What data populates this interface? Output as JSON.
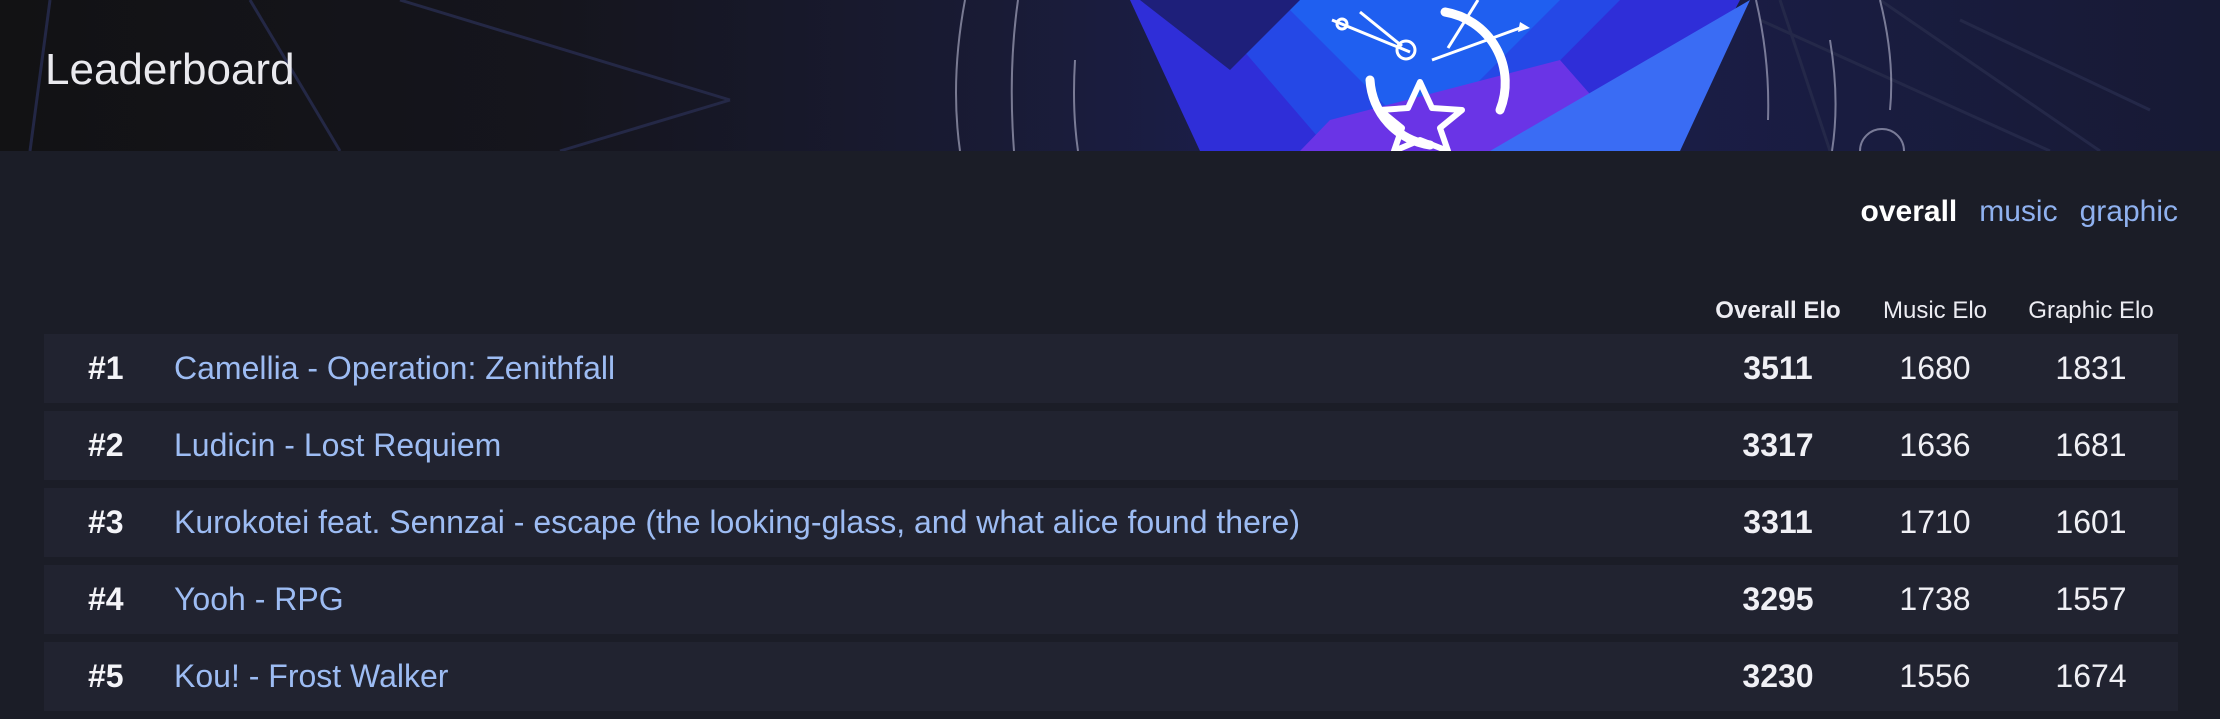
{
  "header": {
    "title": "Leaderboard"
  },
  "category_tabs": [
    {
      "label": "overall",
      "active": true
    },
    {
      "label": "music",
      "active": false
    },
    {
      "label": "graphic",
      "active": false
    }
  ],
  "table": {
    "columns": {
      "overall": "Overall Elo",
      "music": "Music Elo",
      "graphic": "Graphic Elo"
    },
    "rows": [
      {
        "rank": "#1",
        "title": "Camellia - Operation: Zenithfall",
        "overall": "3511",
        "music": "1680",
        "graphic": "1831"
      },
      {
        "rank": "#2",
        "title": "Ludicin - Lost Requiem",
        "overall": "3317",
        "music": "1636",
        "graphic": "1681"
      },
      {
        "rank": "#3",
        "title": "Kurokotei feat. Sennzai - escape (the looking-glass, and what alice found there)",
        "overall": "3311",
        "music": "1710",
        "graphic": "1601"
      },
      {
        "rank": "#4",
        "title": "Yooh - RPG",
        "overall": "3295",
        "music": "1738",
        "graphic": "1557"
      },
      {
        "rank": "#5",
        "title": "Kou! - Frost Walker",
        "overall": "3230",
        "music": "1556",
        "graphic": "1674"
      }
    ]
  },
  "colors": {
    "background": "#1b1d27",
    "row_background": "#212330",
    "link": "#9dbcf3",
    "text": "#f0f0f5",
    "accent_blue": "#2a3fe0",
    "accent_purple": "#5b2de0"
  }
}
